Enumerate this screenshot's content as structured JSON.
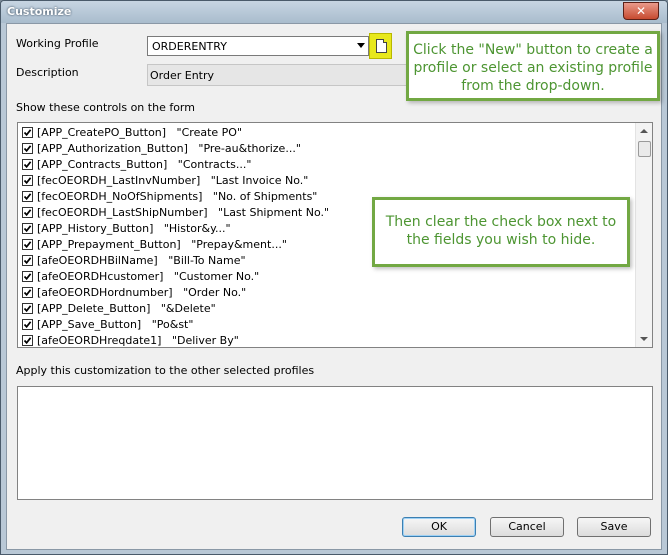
{
  "window": {
    "title": "Customize",
    "close_glyph": "✕"
  },
  "form": {
    "working_profile_label": "Working Profile",
    "working_profile_value": "ORDERENTRY",
    "description_label": "Description",
    "description_value": "Order Entry",
    "controls_label": "Show these controls on the form",
    "apply_label": "Apply this customization to the other selected profiles"
  },
  "callouts": {
    "new_button": "Click the \"New\" button to create a profile or select an existing profile from the drop-down.",
    "checkbox": "Then clear the check box next to the fields you wish to hide."
  },
  "controls": [
    {
      "text": "[APP_CreatePO_Button]   \"Create PO\"",
      "checked": true
    },
    {
      "text": "[APP_Authorization_Button]   \"Pre-au&thorize...\"",
      "checked": true
    },
    {
      "text": "[APP_Contracts_Button]   \"Contracts...\"",
      "checked": true
    },
    {
      "text": "[fecOEORDH_LastInvNumber]   \"Last Invoice No.\"",
      "checked": true
    },
    {
      "text": "[fecOEORDH_NoOfShipments]   \"No. of Shipments\"",
      "checked": true
    },
    {
      "text": "[fecOEORDH_LastShipNumber]   \"Last Shipment No.\"",
      "checked": true
    },
    {
      "text": "[APP_History_Button]   \"Histor&y...\"",
      "checked": true
    },
    {
      "text": "[APP_Prepayment_Button]   \"Prepay&ment...\"",
      "checked": true
    },
    {
      "text": "[afeOEORDHBilName]   \"Bill-To Name\"",
      "checked": true
    },
    {
      "text": "[afeOEORDHcustomer]   \"Customer No.\"",
      "checked": true
    },
    {
      "text": "[afeOEORDHordnumber]   \"Order No.\"",
      "checked": true
    },
    {
      "text": "[APP_Delete_Button]   \"&Delete\"",
      "checked": true
    },
    {
      "text": "[APP_Save_Button]   \"Po&st\"",
      "checked": true
    },
    {
      "text": "[afeOEORDHreqdate1]   \"Deliver By\"",
      "checked": true
    }
  ],
  "buttons": {
    "ok": "OK",
    "cancel": "Cancel",
    "save": "Save"
  },
  "icons": {
    "new": "new-document-icon",
    "dropdown": "chevron-down-icon",
    "close": "close-icon",
    "checkbox": "checkmark-icon"
  },
  "colors": {
    "callout_border": "#72a843",
    "callout_text": "#4d9532",
    "new_button_highlight": "#e8e81c",
    "close_button": "#c74b30"
  }
}
